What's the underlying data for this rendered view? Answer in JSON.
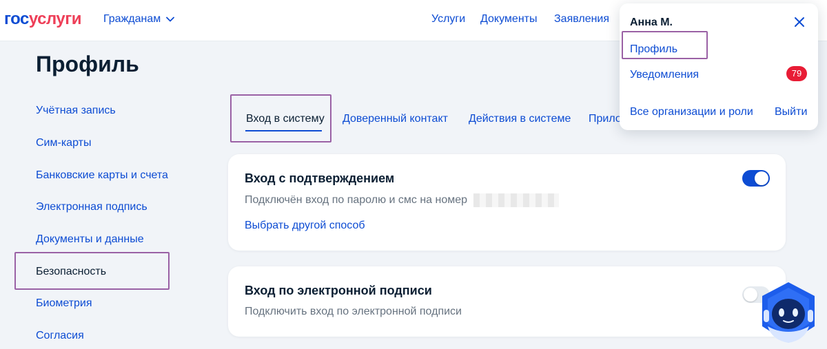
{
  "header": {
    "logo_part1": "гос",
    "logo_part2": "услуги",
    "role_label": "Гражданам",
    "nav": [
      "Услуги",
      "Документы",
      "Заявления"
    ]
  },
  "page": {
    "title": "Профиль"
  },
  "sidebar": {
    "items": [
      "Учётная запись",
      "Сим-карты",
      "Банковские карты и счета",
      "Электронная подпись",
      "Документы и данные",
      "Безопасность",
      "Биометрия",
      "Согласия"
    ],
    "active": "Безопасность"
  },
  "tabs": {
    "items": [
      "Вход в систему",
      "Доверенный контакт",
      "Действия в системе",
      "Прило"
    ],
    "active": "Вход в систему"
  },
  "cards": [
    {
      "title": "Вход с подтверждением",
      "text": "Подключён вход по паролю и смс на номер",
      "link": "Выбрать другой способ",
      "toggle_on": true
    },
    {
      "title": "Вход по электронной подписи",
      "text": "Подключить вход по электронной подписи",
      "toggle_on": false
    }
  ],
  "dropdown": {
    "user_name": "Анна М.",
    "profile_label": "Профиль",
    "notifications_label": "Уведомления",
    "notifications_count": "79",
    "orgs_label": "Все организации и роли",
    "logout_label": "Выйти"
  },
  "colors": {
    "brand_blue": "#0d4cd3",
    "brand_red": "#ee3f58",
    "highlight": "#9a61a5",
    "badge_red": "#e81c35"
  },
  "icons": [
    "chevron-down-icon",
    "close-icon",
    "assistant-robot-icon"
  ]
}
